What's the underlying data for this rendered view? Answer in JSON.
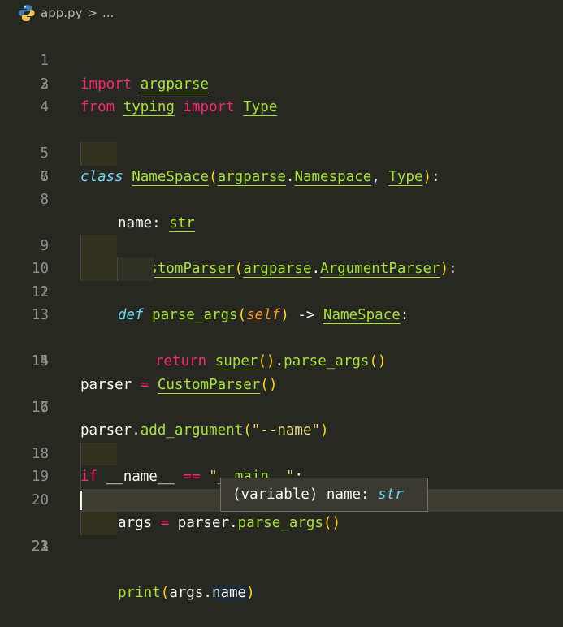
{
  "breadcrumb": {
    "file": "app.py",
    "separator": ">",
    "symbol": "..."
  },
  "editor": {
    "current_line": 21,
    "lines": [
      {
        "n": "1"
      },
      {
        "n": "2"
      },
      {
        "n": "3"
      },
      {
        "n": "4"
      },
      {
        "n": "5"
      },
      {
        "n": "6"
      },
      {
        "n": "7"
      },
      {
        "n": "8"
      },
      {
        "n": "9"
      },
      {
        "n": "10"
      },
      {
        "n": "11"
      },
      {
        "n": "12"
      },
      {
        "n": "13"
      },
      {
        "n": "14"
      },
      {
        "n": "15"
      },
      {
        "n": "16"
      },
      {
        "n": "17"
      },
      {
        "n": "18"
      },
      {
        "n": "19"
      },
      {
        "n": "20"
      },
      {
        "n": "21"
      },
      {
        "n": "22"
      },
      {
        "n": "23"
      }
    ],
    "tokens": {
      "import": "import",
      "argparse": "argparse",
      "from": "from",
      "typing": "typing",
      "Type": "Type",
      "class": "class",
      "NameSpace": "NameSpace",
      "Namespace": "Namespace",
      "name": "name",
      "str": "str",
      "CustomParser": "CustomParser",
      "ArgumentParser": "ArgumentParser",
      "def": "def",
      "parse_args": "parse_args",
      "self": "self",
      "arrow": "->",
      "return": "return",
      "super": "super",
      "parser": "parser",
      "add_argument": "add_argument",
      "name_arg": "\"--name\"",
      "if": "if",
      "dunder_name": "__name__",
      "eq": "==",
      "main_q1": "\"",
      "dunder_main": "__main__",
      "main_q2": "\"",
      "args": "args",
      "print": "print",
      "assign": "="
    }
  },
  "hover": {
    "prefix": "(variable) name: ",
    "type": "str"
  }
}
